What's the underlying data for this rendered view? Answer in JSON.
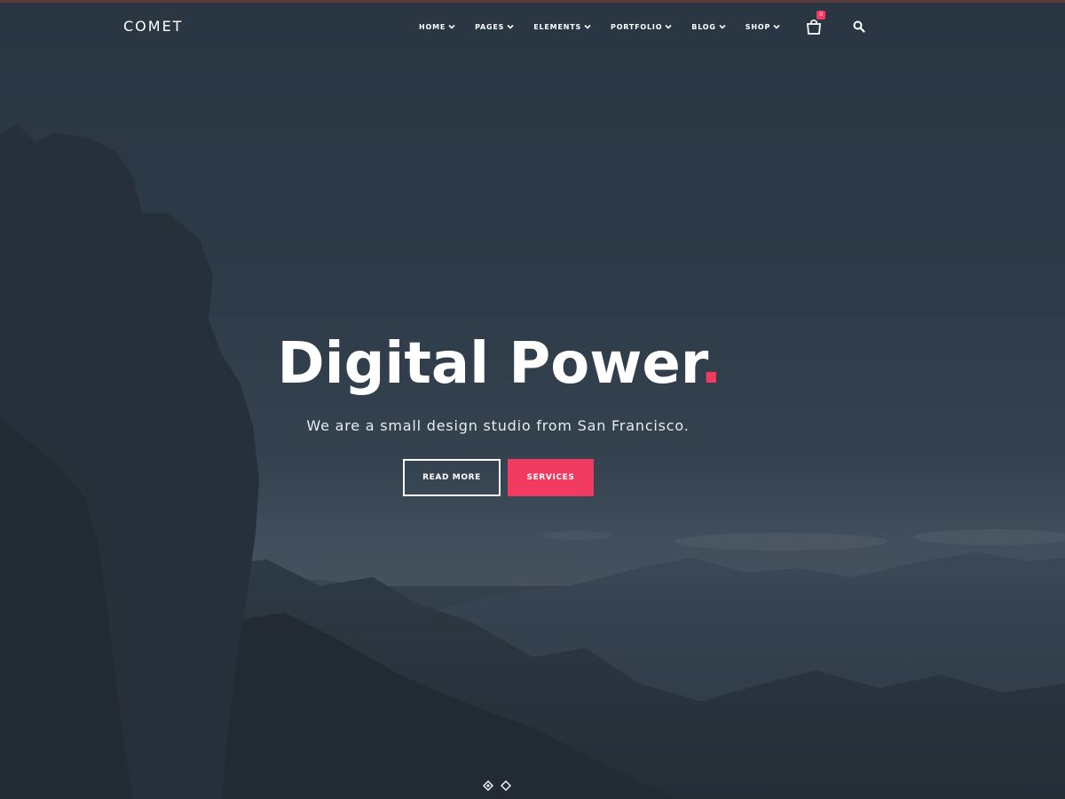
{
  "site": {
    "logo": "COMET"
  },
  "nav": {
    "items": [
      {
        "label": "HOME"
      },
      {
        "label": "PAGES"
      },
      {
        "label": "ELEMENTS"
      },
      {
        "label": "PORTFOLIO"
      },
      {
        "label": "BLOG"
      },
      {
        "label": "SHOP"
      }
    ],
    "cart_icon": "shopping-bag-icon",
    "cart_badge": "0",
    "search_icon": "search-icon",
    "dropdown_icon": "chevron-down-icon"
  },
  "hero": {
    "title": "Digital Power",
    "title_dot": ".",
    "subtitle": "We are a small design studio from San Francisco.",
    "read_more_label": "READ MORE",
    "services_label": "SERVICES"
  },
  "slider": {
    "slide_count": 2,
    "active_index": 0
  },
  "colors": {
    "accent": "#f03a5f",
    "background": "#2d3a47",
    "text": "#ffffff"
  }
}
